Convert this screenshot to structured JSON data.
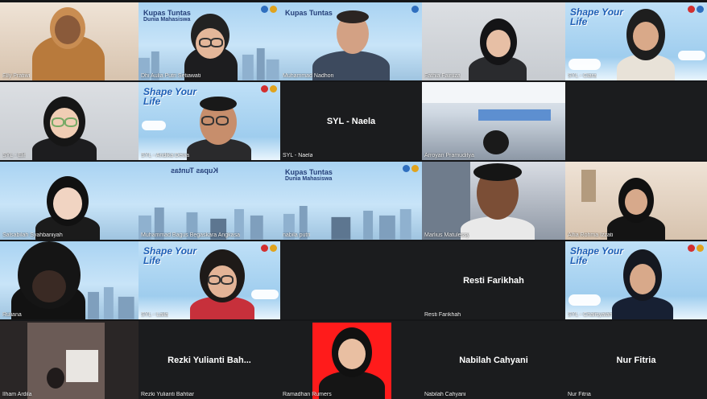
{
  "participants": [
    {
      "name": "Elly Pratiwi"
    },
    {
      "name": "Dhi Aulia Putri Setiawati"
    },
    {
      "name": "Muhammad Nadhon"
    },
    {
      "name": "Fathia Fairuza"
    },
    {
      "name": "SYL - Clara"
    },
    {
      "name": "SYL - Elif"
    },
    {
      "name": "SYL - Andika Dewa"
    },
    {
      "name": "SYL - Naela",
      "center": "SYL - Naela"
    },
    {
      "name": "Arroyan Pramuditya"
    },
    {
      "name": ""
    },
    {
      "name": "Salsabilah Syahbaniyah"
    },
    {
      "name": "Muhammad Bagus Begaskara Angkasa"
    },
    {
      "name": "nabila putri"
    },
    {
      "name": "Marlius Matulessy"
    },
    {
      "name": "Alfia Rohma Izzati"
    },
    {
      "name": "Ruliana"
    },
    {
      "name": "SYL - Laila"
    },
    {
      "name": ""
    },
    {
      "name": "Resti Farikhah",
      "center": "Resti Farikhah"
    },
    {
      "name": "SYL - Chalisyalah"
    },
    {
      "name": "Ilham Ardila"
    },
    {
      "name": "Rezki Yulianti Bahtiar",
      "center": "Rezki  Yulianti  Bah..."
    },
    {
      "name": "Ramadhan Rumers"
    },
    {
      "name": "Nabilah Cahyani",
      "center": "Nabilah Cahyani"
    },
    {
      "name": "Nur Fitria",
      "center": "Nur Fitria"
    }
  ],
  "branding": {
    "shape_your_life": "Shape Your Life",
    "kupas_tuntas": "Kupas Tuntas",
    "kupas_sub": "Dunia Mahasiswa",
    "kupas_mirrored": "Kupas Tuntas"
  },
  "colors": {
    "background": "#151618",
    "accent_red": "#ff1b1b",
    "sky": "#a9d3f2"
  }
}
